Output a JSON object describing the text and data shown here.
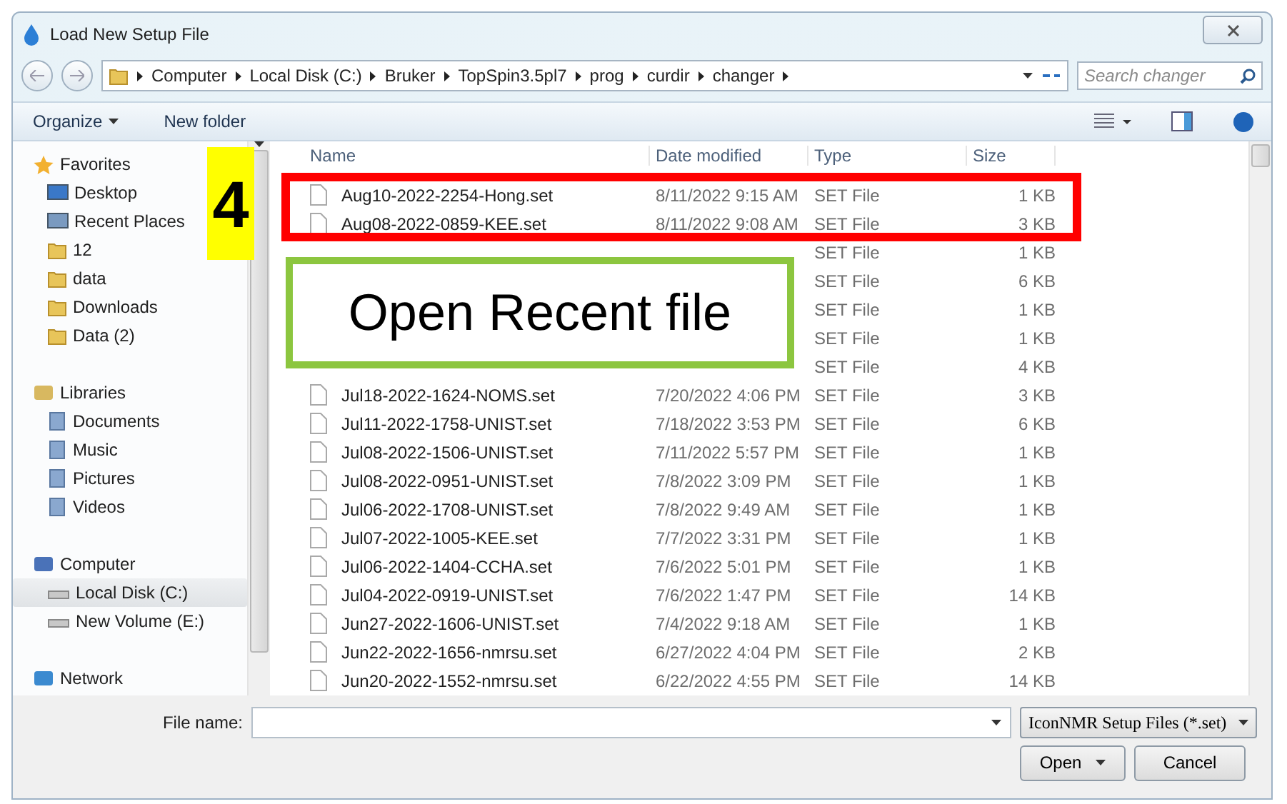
{
  "window": {
    "title": "Load New Setup File"
  },
  "address": {
    "path": [
      "Computer",
      "Local Disk (C:)",
      "Bruker",
      "TopSpin3.5pl7",
      "prog",
      "curdir",
      "changer"
    ]
  },
  "search": {
    "placeholder": "Search changer"
  },
  "toolbar": {
    "organize": "Organize",
    "new_folder": "New folder"
  },
  "sidebar": {
    "groups": [
      {
        "label": "Favorites",
        "items": [
          {
            "label": "Desktop",
            "selected": false
          },
          {
            "label": "Recent Places",
            "selected": false
          },
          {
            "label": "12",
            "selected": false
          },
          {
            "label": "data",
            "selected": false
          },
          {
            "label": "Downloads",
            "selected": false
          },
          {
            "label": "Data (2)",
            "selected": false
          }
        ]
      },
      {
        "label": "Libraries",
        "items": [
          {
            "label": "Documents",
            "selected": false
          },
          {
            "label": "Music",
            "selected": false
          },
          {
            "label": "Pictures",
            "selected": false
          },
          {
            "label": "Videos",
            "selected": false
          }
        ]
      },
      {
        "label": "Computer",
        "items": [
          {
            "label": "Local Disk (C:)",
            "selected": true
          },
          {
            "label": "New Volume (E:)",
            "selected": false
          }
        ]
      },
      {
        "label": "Network"
      }
    ]
  },
  "table": {
    "columns": [
      "Name",
      "Date modified",
      "Type",
      "Size"
    ],
    "rows": [
      {
        "name": "Aug10-2022-2254-Hong.set",
        "date": "8/11/2022 9:15 AM",
        "type": "SET File",
        "size": "1 KB"
      },
      {
        "name": "Aug08-2022-0859-KEE.set",
        "date": "8/11/2022 9:08 AM",
        "type": "SET File",
        "size": "3 KB"
      },
      {
        "type": "SET File",
        "size": "1 KB"
      },
      {
        "type": "SET File",
        "size": "6 KB"
      },
      {
        "type": "SET File",
        "size": "1 KB"
      },
      {
        "type": "SET File",
        "size": "1 KB"
      },
      {
        "type": "SET File",
        "size": "4 KB"
      },
      {
        "name": "Jul18-2022-1624-NOMS.set",
        "date": "7/20/2022 4:06 PM",
        "type": "SET File",
        "size": "3 KB"
      },
      {
        "name": "Jul11-2022-1758-UNIST.set",
        "date": "7/18/2022 3:53 PM",
        "type": "SET File",
        "size": "6 KB"
      },
      {
        "name": "Jul08-2022-1506-UNIST.set",
        "date": "7/11/2022 5:57 PM",
        "type": "SET File",
        "size": "1 KB"
      },
      {
        "name": "Jul08-2022-0951-UNIST.set",
        "date": "7/8/2022 3:09 PM",
        "type": "SET File",
        "size": "1 KB"
      },
      {
        "name": "Jul06-2022-1708-UNIST.set",
        "date": "7/8/2022 9:49 AM",
        "type": "SET File",
        "size": "1 KB"
      },
      {
        "name": "Jul07-2022-1005-KEE.set",
        "date": "7/7/2022 3:31 PM",
        "type": "SET File",
        "size": "1 KB"
      },
      {
        "name": "Jul06-2022-1404-CCHA.set",
        "date": "7/6/2022 5:01 PM",
        "type": "SET File",
        "size": "1 KB"
      },
      {
        "name": "Jul04-2022-0919-UNIST.set",
        "date": "7/6/2022 1:47 PM",
        "type": "SET File",
        "size": "14 KB"
      },
      {
        "name": "Jun27-2022-1606-UNIST.set",
        "date": "7/4/2022 9:18 AM",
        "type": "SET File",
        "size": "1 KB"
      },
      {
        "name": "Jun22-2022-1656-nmrsu.set",
        "date": "6/27/2022 4:04 PM",
        "type": "SET File",
        "size": "2 KB"
      },
      {
        "name": "Jun20-2022-1552-nmrsu.set",
        "date": "6/22/2022 4:55 PM",
        "type": "SET File",
        "size": "14 KB"
      }
    ]
  },
  "footer": {
    "file_name_label": "File name:",
    "filter": "IconNMR Setup Files (*.set)",
    "buttons": [
      "Open",
      "Cancel"
    ]
  },
  "annotations": {
    "step": "4",
    "callout": "Open Recent file"
  }
}
